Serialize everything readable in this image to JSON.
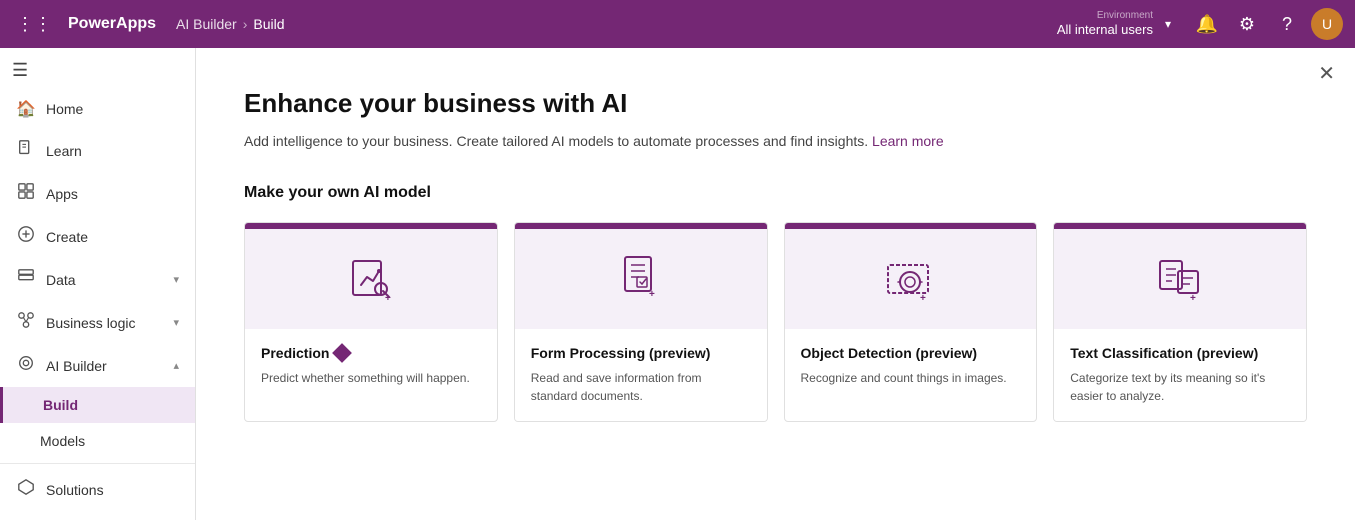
{
  "topnav": {
    "app_name": "PowerApps",
    "breadcrumb_parent": "AI Builder",
    "breadcrumb_separator": "›",
    "breadcrumb_current": "Build",
    "environment_label": "Environment",
    "environment_name": "All internal users",
    "avatar_initials": "U"
  },
  "sidebar": {
    "collapse_label": "Collapse",
    "items": [
      {
        "id": "home",
        "label": "Home",
        "icon": "⌂",
        "has_chevron": false,
        "active": false,
        "indent": false
      },
      {
        "id": "learn",
        "label": "Learn",
        "icon": "📖",
        "has_chevron": false,
        "active": false,
        "indent": false
      },
      {
        "id": "apps",
        "label": "Apps",
        "icon": "⊡",
        "has_chevron": false,
        "active": false,
        "indent": false
      },
      {
        "id": "create",
        "label": "Create",
        "icon": "+",
        "has_chevron": false,
        "active": false,
        "indent": false
      },
      {
        "id": "data",
        "label": "Data",
        "icon": "⊞",
        "has_chevron": true,
        "active": false,
        "indent": false
      },
      {
        "id": "business-logic",
        "label": "Business logic",
        "icon": "⊛",
        "has_chevron": true,
        "active": false,
        "indent": false
      },
      {
        "id": "ai-builder",
        "label": "AI Builder",
        "icon": "⊙",
        "has_chevron": true,
        "active": false,
        "indent": false,
        "expanded": true
      },
      {
        "id": "build",
        "label": "Build",
        "icon": "",
        "has_chevron": false,
        "active": true,
        "indent": true
      },
      {
        "id": "models",
        "label": "Models",
        "icon": "",
        "has_chevron": false,
        "active": false,
        "indent": true
      },
      {
        "id": "solutions",
        "label": "Solutions",
        "icon": "⬡",
        "has_chevron": false,
        "active": false,
        "indent": false
      }
    ]
  },
  "content": {
    "title": "Enhance your business with AI",
    "subtitle": "Add intelligence to your business. Create tailored AI models to automate processes and find insights.",
    "learn_more_label": "Learn more",
    "section_title": "Make your own AI model",
    "cards": [
      {
        "id": "prediction",
        "title": "Prediction",
        "has_badge": true,
        "description": "Predict whether something will happen."
      },
      {
        "id": "form-processing",
        "title": "Form Processing (preview)",
        "has_badge": false,
        "description": "Read and save information from standard documents."
      },
      {
        "id": "object-detection",
        "title": "Object Detection (preview)",
        "has_badge": false,
        "description": "Recognize and count things in images."
      },
      {
        "id": "text-classification",
        "title": "Text Classification (preview)",
        "has_badge": false,
        "description": "Categorize text by its meaning so it's easier to analyze."
      }
    ]
  }
}
